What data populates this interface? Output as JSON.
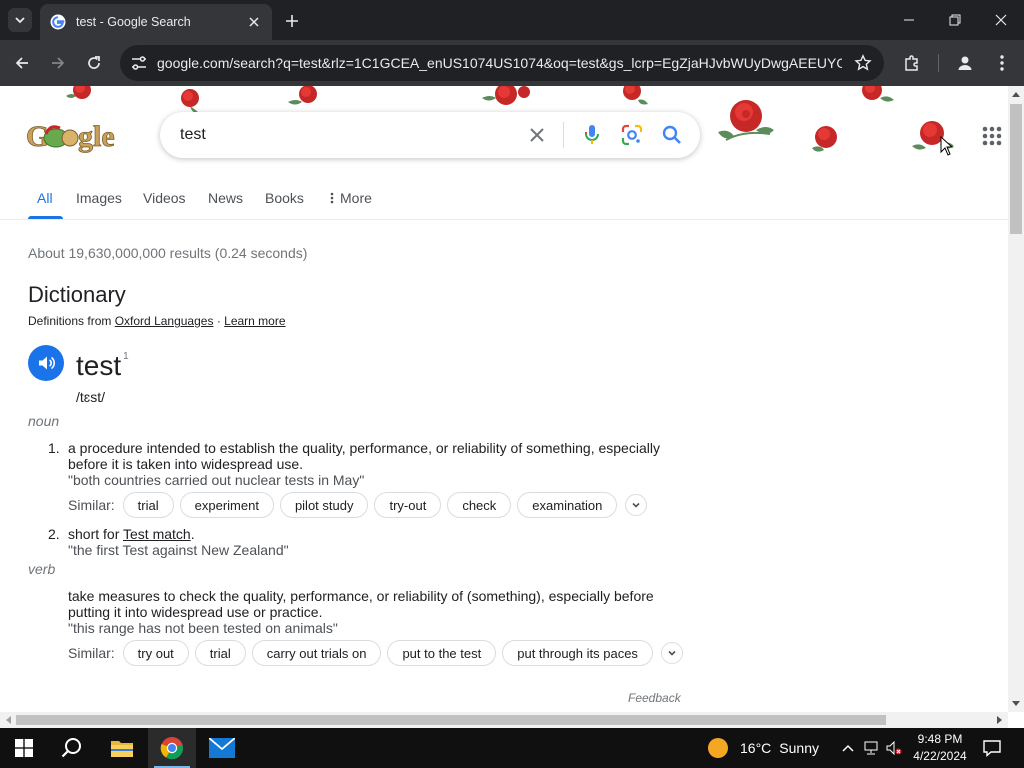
{
  "browser": {
    "tab_title": "test - Google Search",
    "url": "google.com/search?q=test&rlz=1C1GCEA_enUS1074US1074&oq=test&gs_lcrp=EgZjaHJvbWUyDwgAEEUYOR..."
  },
  "search": {
    "query": "test"
  },
  "tabs": [
    {
      "label": "All"
    },
    {
      "label": "Images"
    },
    {
      "label": "Videos"
    },
    {
      "label": "News"
    },
    {
      "label": "Books"
    },
    {
      "label": "More"
    }
  ],
  "results_stats": "About 19,630,000,000 results (0.24 seconds)",
  "dictionary": {
    "title": "Dictionary",
    "definitions_from": "Definitions from",
    "source": "Oxford Languages",
    "separator": "·",
    "learn_more": "Learn more",
    "word": "test",
    "superscript": "1",
    "phonetic": "/tɛst/",
    "noun_label": "noun",
    "verb_label": "verb",
    "similar_label": "Similar:",
    "noun_defs": [
      {
        "num": "1.",
        "text": "a procedure intended to establish the quality, performance, or reliability of something, especially before it is taken into widespread use.",
        "example": "\"both countries carried out nuclear tests in May\"",
        "similar": [
          "trial",
          "experiment",
          "pilot study",
          "try-out",
          "check",
          "examination"
        ]
      },
      {
        "num": "2.",
        "text_prefix": "short for",
        "link": "Test match",
        "text_suffix": ".",
        "example": "\"the first Test against New Zealand\""
      }
    ],
    "verb_def": {
      "text": "take measures to check the quality, performance, or reliability of (something), especially before putting it into widespread use or practice.",
      "example": "\"this range has not been tested on animals\"",
      "similar": [
        "try out",
        "trial",
        "carry out trials on",
        "put to the test",
        "put through its paces"
      ]
    },
    "feedback": "Feedback"
  },
  "taskbar": {
    "weather_temp": "16°C",
    "weather_desc": "Sunny",
    "time": "9:48 PM",
    "date": "4/22/2024"
  },
  "colors": {
    "accent": "#1a73e8",
    "rose": "#c62828",
    "chrome_dark": "#202124"
  }
}
